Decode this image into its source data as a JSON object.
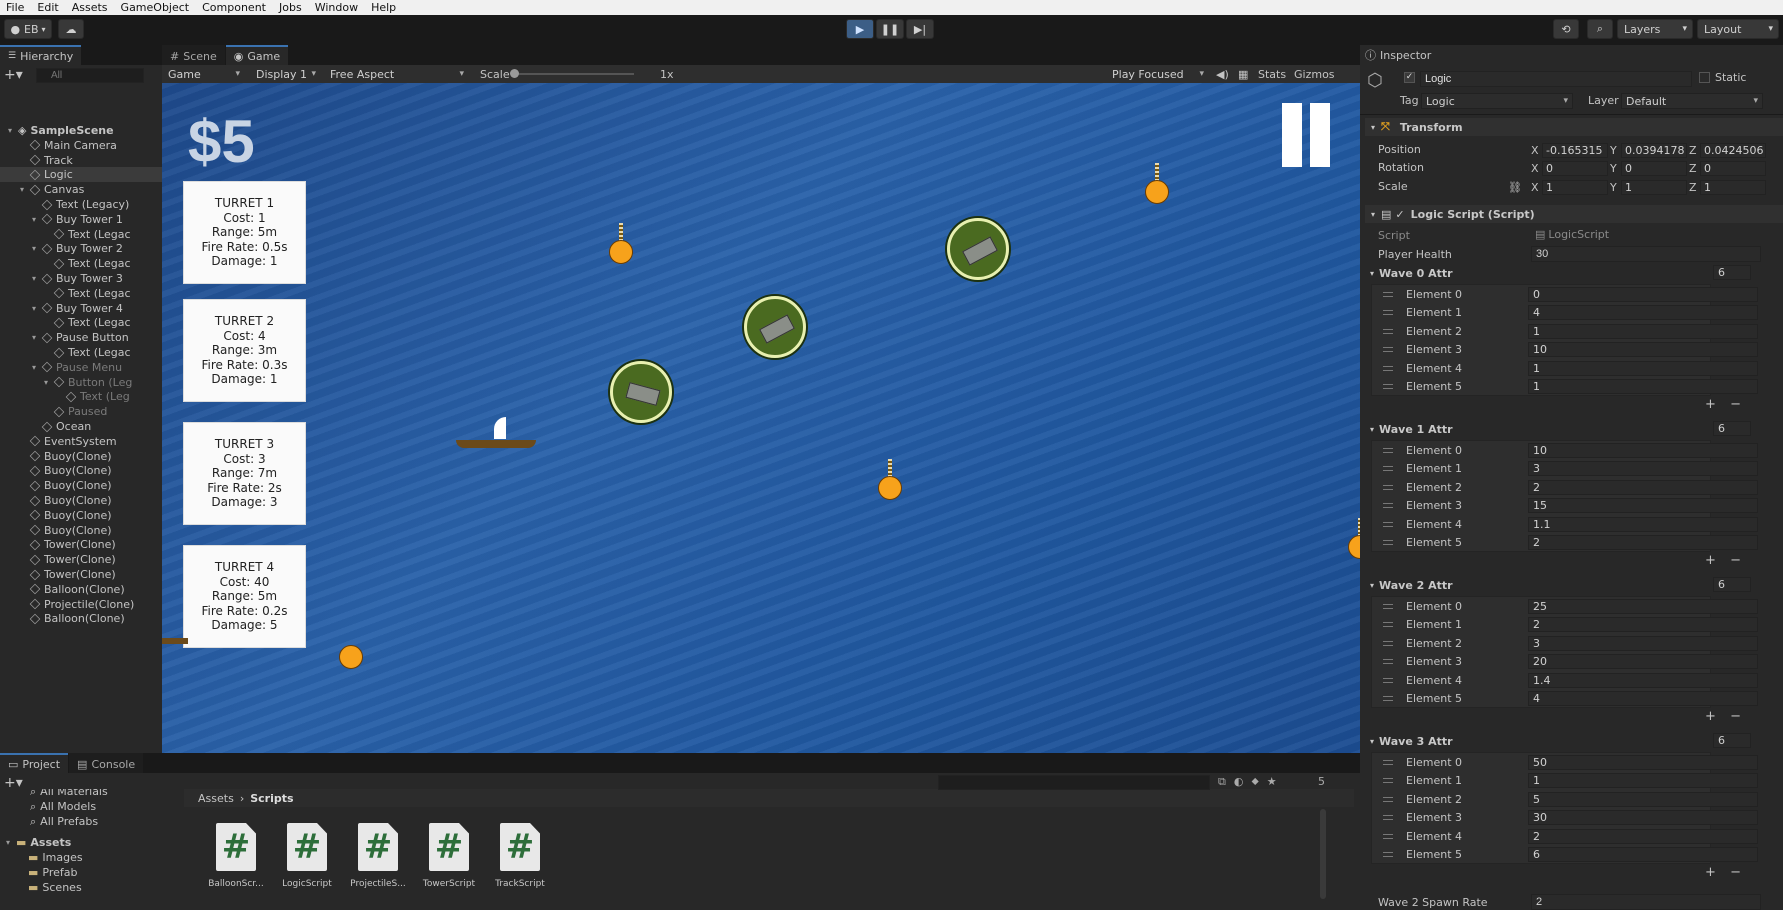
{
  "menu": [
    "File",
    "Edit",
    "Assets",
    "GameObject",
    "Component",
    "Jobs",
    "Window",
    "Help"
  ],
  "toolbar": {
    "account": "EB",
    "layers": "Layers",
    "layout": "Layout"
  },
  "hierarchy": {
    "tab": "Hierarchy",
    "search_placeholder": "All",
    "items": [
      {
        "label": "SampleScene",
        "depth": 0,
        "arrow": "▾",
        "kind": "scene"
      },
      {
        "label": "Main Camera",
        "depth": 1
      },
      {
        "label": "Track",
        "depth": 1
      },
      {
        "label": "Logic",
        "depth": 1,
        "selected": true
      },
      {
        "label": "Canvas",
        "depth": 1,
        "arrow": "▾"
      },
      {
        "label": "Text (Legacy)",
        "depth": 2
      },
      {
        "label": "Buy Tower 1",
        "depth": 2,
        "arrow": "▾"
      },
      {
        "label": "Text (Legac",
        "depth": 3
      },
      {
        "label": "Buy Tower 2",
        "depth": 2,
        "arrow": "▾"
      },
      {
        "label": "Text (Legac",
        "depth": 3
      },
      {
        "label": "Buy Tower 3",
        "depth": 2,
        "arrow": "▾"
      },
      {
        "label": "Text (Legac",
        "depth": 3
      },
      {
        "label": "Buy Tower 4",
        "depth": 2,
        "arrow": "▾"
      },
      {
        "label": "Text (Legac",
        "depth": 3
      },
      {
        "label": "Pause Button",
        "depth": 2,
        "arrow": "▾"
      },
      {
        "label": "Text (Legac",
        "depth": 3
      },
      {
        "label": "Pause Menu",
        "depth": 2,
        "arrow": "▾",
        "dim": true
      },
      {
        "label": "Button (Leg",
        "depth": 3,
        "arrow": "▾",
        "dim": true
      },
      {
        "label": "Text (Leg",
        "depth": 4,
        "dim": true
      },
      {
        "label": "Paused",
        "depth": 3,
        "dim": true
      },
      {
        "label": "Ocean",
        "depth": 2
      },
      {
        "label": "EventSystem",
        "depth": 1
      },
      {
        "label": "Buoy(Clone)",
        "depth": 1
      },
      {
        "label": "Buoy(Clone)",
        "depth": 1
      },
      {
        "label": "Buoy(Clone)",
        "depth": 1
      },
      {
        "label": "Buoy(Clone)",
        "depth": 1
      },
      {
        "label": "Buoy(Clone)",
        "depth": 1
      },
      {
        "label": "Buoy(Clone)",
        "depth": 1
      },
      {
        "label": "Tower(Clone)",
        "depth": 1
      },
      {
        "label": "Tower(Clone)",
        "depth": 1
      },
      {
        "label": "Tower(Clone)",
        "depth": 1
      },
      {
        "label": "Balloon(Clone)",
        "depth": 1
      },
      {
        "label": "Projectile(Clone)",
        "depth": 1
      },
      {
        "label": "Balloon(Clone)",
        "depth": 1
      }
    ]
  },
  "game": {
    "tab_scene": "Scene",
    "tab_game": "Game",
    "display_mode": "Game",
    "display": "Display 1",
    "aspect": "Free Aspect",
    "scale_label": "Scale",
    "scale_value": "1x",
    "play_focused": "Play Focused",
    "stats": "Stats",
    "gizmos": "Gizmos",
    "money": "$5",
    "turrets": [
      {
        "title": "TURRET 1",
        "cost": "Cost: 1",
        "range": "Range: 5m",
        "fire_rate": "Fire Rate: 0.5s",
        "damage": "Damage: 1"
      },
      {
        "title": "TURRET 2",
        "cost": "Cost: 4",
        "range": "Range: 3m",
        "fire_rate": "Fire Rate: 0.3s",
        "damage": "Damage: 1"
      },
      {
        "title": "TURRET 3",
        "cost": "Cost: 3",
        "range": "Range: 7m",
        "fire_rate": "Fire Rate: 2s",
        "damage": "Damage: 3"
      },
      {
        "title": "TURRET 4",
        "cost": "Cost: 40",
        "range": "Range: 5m",
        "fire_rate": "Fire Rate: 0.2s",
        "damage": "Damage: 5"
      }
    ]
  },
  "inspector": {
    "tab": "Inspector",
    "object_name": "Logic",
    "static_label": "Static",
    "tag_label": "Tag",
    "tag_value": "Logic",
    "layer_label": "Layer",
    "layer_value": "Default",
    "transform": {
      "title": "Transform",
      "position_label": "Position",
      "rotation_label": "Rotation",
      "scale_label": "Scale",
      "px": "-0.165315",
      "py": "0.0394178",
      "pz": "0.0424506",
      "rx": "0",
      "ry": "0",
      "rz": "0",
      "sx": "1",
      "sy": "1",
      "sz": "1"
    },
    "script": {
      "title": "Logic Script (Script)",
      "script_label": "Script",
      "script_value": "LogicScript",
      "health_label": "Player Health",
      "health_value": "30"
    },
    "waves": [
      {
        "title": "Wave 0 Attr",
        "count": "6",
        "values": [
          "0",
          "4",
          "1",
          "10",
          "1",
          "1"
        ]
      },
      {
        "title": "Wave 1 Attr",
        "count": "6",
        "values": [
          "10",
          "3",
          "2",
          "15",
          "1.1",
          "2"
        ]
      },
      {
        "title": "Wave 2 Attr",
        "count": "6",
        "values": [
          "25",
          "2",
          "3",
          "20",
          "1.4",
          "4"
        ]
      },
      {
        "title": "Wave 3 Attr",
        "count": "6",
        "values": [
          "50",
          "1",
          "5",
          "30",
          "2",
          "6"
        ]
      }
    ],
    "element_labels": [
      "Element 0",
      "Element 1",
      "Element 2",
      "Element 3",
      "Element 4",
      "Element 5"
    ],
    "spawn_label": "Wave 2 Spawn Rate",
    "spawn_value": "2"
  },
  "project": {
    "tab_project": "Project",
    "tab_console": "Console",
    "favorites": [
      "All Materials",
      "All Models",
      "All Prefabs"
    ],
    "assets_label": "Assets",
    "folders": [
      "Images",
      "Prefab",
      "Scenes"
    ],
    "breadcrumb_root": "Assets",
    "breadcrumb_current": "Scripts",
    "hidden_count": "5",
    "files": [
      "BalloonScr...",
      "LogicScript",
      "ProjectileS...",
      "TowerScript",
      "TrackScript"
    ]
  }
}
